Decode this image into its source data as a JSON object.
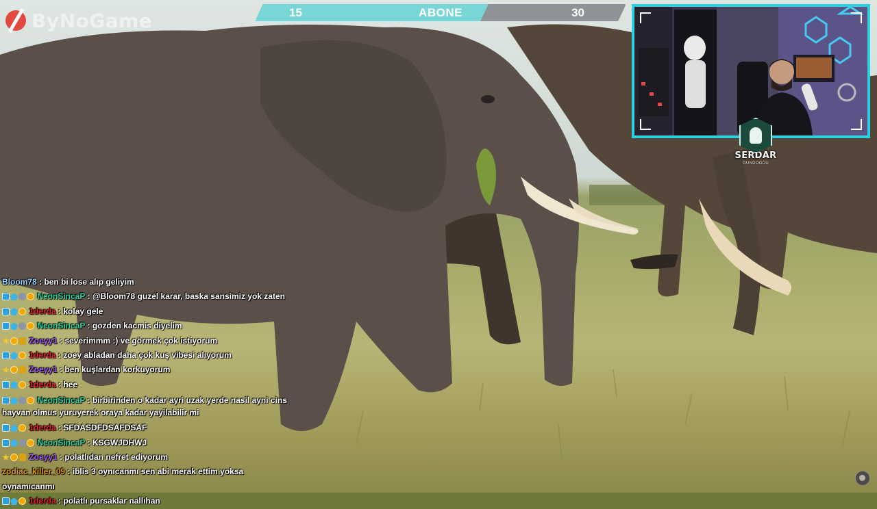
{
  "watermark": {
    "text": "ByNoGame"
  },
  "goal": {
    "start": "15",
    "title": "ABONE",
    "end": "30",
    "progress": 0.62,
    "fill_color": "#79d6d6",
    "bar_color": "#8f9397"
  },
  "webcam": {
    "frame_color": "#2ed0e0"
  },
  "streamer": {
    "name": "SERDAR",
    "subtitle": "GUNDOGDU"
  },
  "chat": {
    "messages": [
      {
        "badges": [],
        "user": "Bloom78",
        "color": "#9ad1ff",
        "text": "ben bi lose alıp geliyim"
      },
      {
        "badges": [
          "mod",
          "sub",
          "gift",
          "vip"
        ],
        "user": "NeonSincaP",
        "color": "#2ed3a1",
        "text": "@Bloom78 guzel karar, baska sansimiz yok zaten"
      },
      {
        "badges": [
          "mod",
          "sub",
          "vip"
        ],
        "user": "1derda",
        "color": "#e0232f",
        "text": "kolay gele"
      },
      {
        "badges": [
          "mod",
          "sub",
          "gift",
          "vip"
        ],
        "user": "NeonSincaP",
        "color": "#2ed3a1",
        "text": "gozden kacmis diyelim"
      },
      {
        "badges": [
          "star",
          "vip",
          "bits"
        ],
        "user": "Zoeyy1",
        "color": "#a55cf0",
        "text": "severimmm :) ve görmek çok istiyorum"
      },
      {
        "badges": [
          "mod",
          "sub",
          "vip"
        ],
        "user": "1derda",
        "color": "#e0232f",
        "text": "zoey abladan daha çok kuş vibesi alıyorum"
      },
      {
        "badges": [
          "star",
          "vip",
          "bits"
        ],
        "user": "Zoeyy1",
        "color": "#a55cf0",
        "text": "ben kuşlardan korkuyorum"
      },
      {
        "badges": [
          "mod",
          "sub",
          "vip"
        ],
        "user": "1derda",
        "color": "#e0232f",
        "text": "hee"
      },
      {
        "badges": [
          "mod",
          "sub",
          "gift",
          "vip"
        ],
        "user": "NeonSincaP",
        "color": "#2ed3a1",
        "text": "birbirinden o kadar ayri uzak yerde nasil ayni cins hayvan olmus yuruyerek oraya kadar yayilabilir mi",
        "wrap": true
      },
      {
        "badges": [
          "mod",
          "sub",
          "vip"
        ],
        "user": "1derda",
        "color": "#e0232f",
        "text": "SFDASDFDSAFDSAF"
      },
      {
        "badges": [
          "mod",
          "sub",
          "gift",
          "vip"
        ],
        "user": "NeonSincaP",
        "color": "#2ed3a1",
        "text": "KSGWJDHWJ"
      },
      {
        "badges": [
          "star",
          "vip",
          "bits"
        ],
        "user": "Zoeyy1",
        "color": "#a55cf0",
        "text": "polatlıdan nefret ediyorum"
      },
      {
        "badges": [],
        "user": "zodiac_killer_09",
        "color": "#e39a1c",
        "text": "iblis 3 oynıcanmı sen abi merak ettim yoksa oynamıcanmı"
      },
      {
        "badges": [
          "mod",
          "sub",
          "vip"
        ],
        "user": "1derda",
        "color": "#e0232f",
        "text": "polatlı pursaklar nallıhan"
      }
    ]
  }
}
